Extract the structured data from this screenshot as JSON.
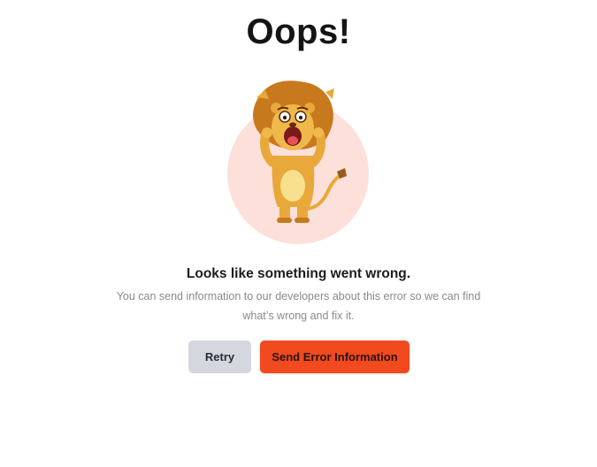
{
  "error_page": {
    "title": "Oops!",
    "heading": "Looks like something went wrong.",
    "message": "You can send information to our developers about this error so we can find what’s wrong and fix it.",
    "illustration_icon": "scared-lion-illustration"
  },
  "actions": {
    "retry_label": "Retry",
    "send_label": "Send Error Information"
  },
  "colors": {
    "accent": "#f04a1e",
    "secondary_button": "#d5d7de",
    "illustration_circle": "#fde0da"
  }
}
